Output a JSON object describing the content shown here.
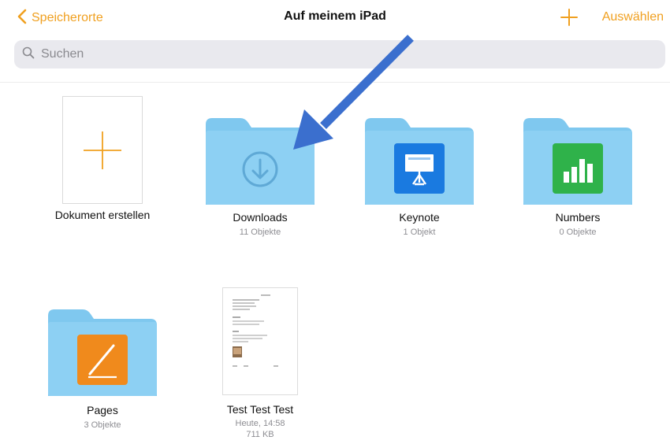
{
  "nav": {
    "back_label": "Speicherorte",
    "title": "Auf meinem iPad",
    "select_label": "Auswählen"
  },
  "search": {
    "placeholder": "Suchen"
  },
  "items": [
    {
      "name": "Dokument erstellen",
      "meta": ""
    },
    {
      "name": "Downloads",
      "meta": "11 Objekte"
    },
    {
      "name": "Keynote",
      "meta": "1 Objekt"
    },
    {
      "name": "Numbers",
      "meta": "0 Objekte"
    },
    {
      "name": "Pages",
      "meta": "3 Objekte"
    },
    {
      "name": "Test Test Test",
      "meta": "Heute, 14:58",
      "size": "711 KB"
    }
  ],
  "colors": {
    "accent": "#f0a020",
    "folder": "#7fc8ef",
    "keynote": "#1a7ae0",
    "numbers": "#2fb24a",
    "pages": "#f08a1c",
    "annotation_arrow": "#3b6fce"
  },
  "icons": [
    "chevron-left-icon",
    "plus-icon",
    "search-icon",
    "download-icon",
    "keynote-app-icon",
    "numbers-app-icon",
    "pages-app-icon"
  ]
}
